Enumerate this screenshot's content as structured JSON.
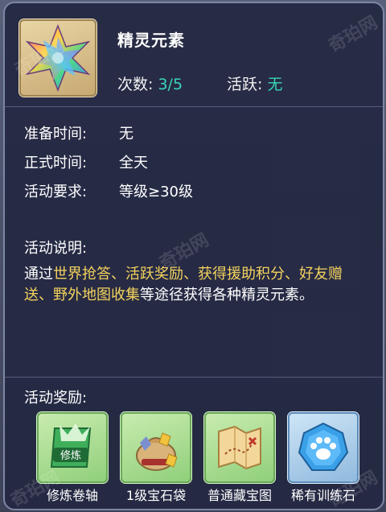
{
  "item": {
    "title": "精灵元素",
    "icon": "rainbow-star-crystal-icon"
  },
  "stats": {
    "count_label": "次数:",
    "count_value": "3/5",
    "active_label": "活跃:",
    "active_value": "无"
  },
  "info": [
    {
      "label": "准备时间:",
      "value": "无"
    },
    {
      "label": "正式时间:",
      "value": "全天"
    },
    {
      "label": "活动要求:",
      "value": "等级≥30级"
    }
  ],
  "description": {
    "label": "活动说明:",
    "parts": [
      {
        "text": "通过",
        "highlight": false
      },
      {
        "text": "世界抢答、活跃奖励、获得援助积分、好友赠送、野外地图收集",
        "highlight": true
      },
      {
        "text": "等途径获得各种精灵元素。",
        "highlight": false
      }
    ]
  },
  "rewards": {
    "label": "活动奖励:",
    "items": [
      {
        "name": "修炼卷轴",
        "icon": "cultivation-scroll-icon",
        "icon_text": "修炼"
      },
      {
        "name": "1级宝石袋",
        "icon": "gem-bag-icon"
      },
      {
        "name": "普通藏宝图",
        "icon": "treasure-map-icon"
      },
      {
        "name": "稀有训练石",
        "icon": "paw-training-stone-icon"
      }
    ]
  },
  "colors": {
    "highlight": "#f4d35e",
    "value_teal": "#39d6b6",
    "panel_bg": "#242842"
  },
  "watermark": "奇珀网"
}
